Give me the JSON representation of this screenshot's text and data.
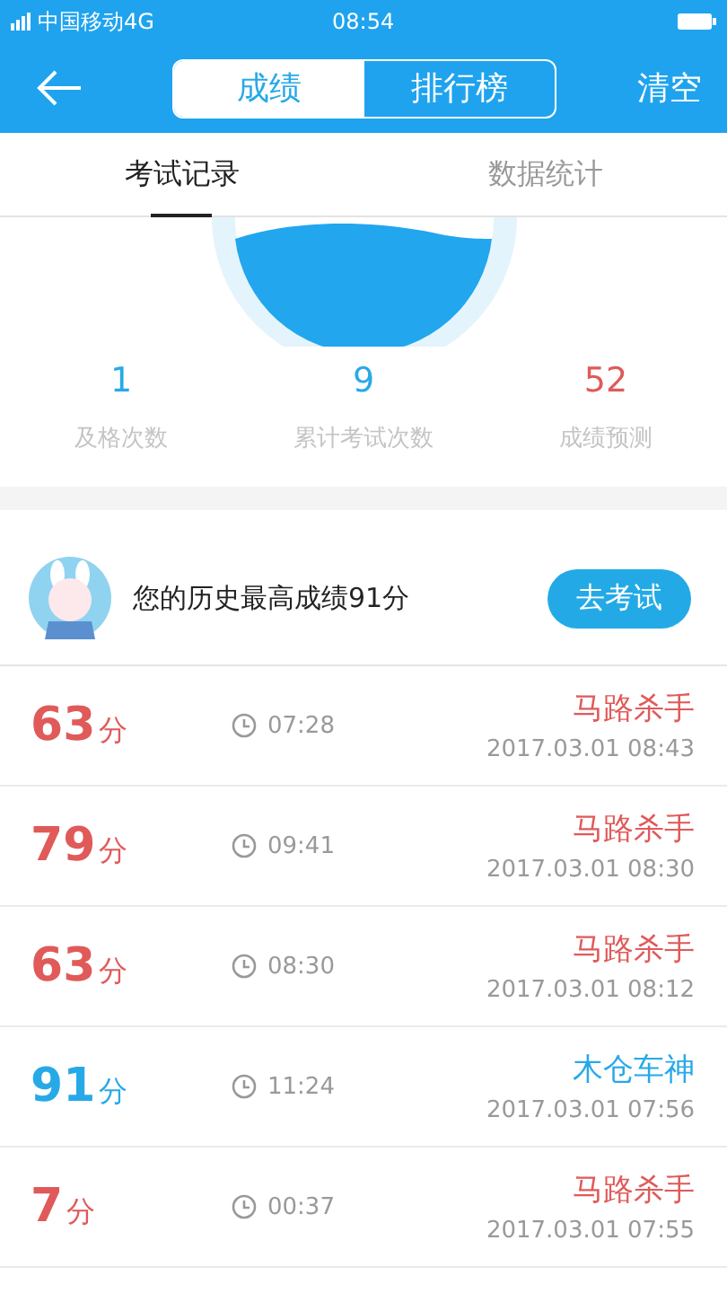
{
  "status_bar": {
    "carrier": "中国移动4G",
    "time": "08:54"
  },
  "header": {
    "segments": [
      {
        "label": "成绩",
        "selected": true
      },
      {
        "label": "排行榜",
        "selected": false
      }
    ],
    "action": "清空"
  },
  "tabs": [
    {
      "label": "考试记录",
      "selected": true
    },
    {
      "label": "数据统计",
      "selected": false
    }
  ],
  "stats": [
    {
      "value": "1",
      "label": "及格次数",
      "kind": "good"
    },
    {
      "value": "9",
      "label": "累计考试次数",
      "kind": "good"
    },
    {
      "value": "52",
      "label": "成绩预测",
      "kind": "bad"
    }
  ],
  "best": {
    "text": "您的历史最高成绩91分",
    "button": "去考试"
  },
  "records": [
    {
      "score": "63",
      "unit": "分",
      "passed": false,
      "duration": "07:28",
      "title": "马路杀手",
      "date": "2017.03.01  08:43"
    },
    {
      "score": "79",
      "unit": "分",
      "passed": false,
      "duration": "09:41",
      "title": "马路杀手",
      "date": "2017.03.01  08:30"
    },
    {
      "score": "63",
      "unit": "分",
      "passed": false,
      "duration": "08:30",
      "title": "马路杀手",
      "date": "2017.03.01  08:12"
    },
    {
      "score": "91",
      "unit": "分",
      "passed": true,
      "duration": "11:24",
      "title": "木仓车神",
      "date": "2017.03.01  07:56"
    },
    {
      "score": "7",
      "unit": "分",
      "passed": false,
      "duration": "00:37",
      "title": "马路杀手",
      "date": "2017.03.01  07:55"
    }
  ]
}
